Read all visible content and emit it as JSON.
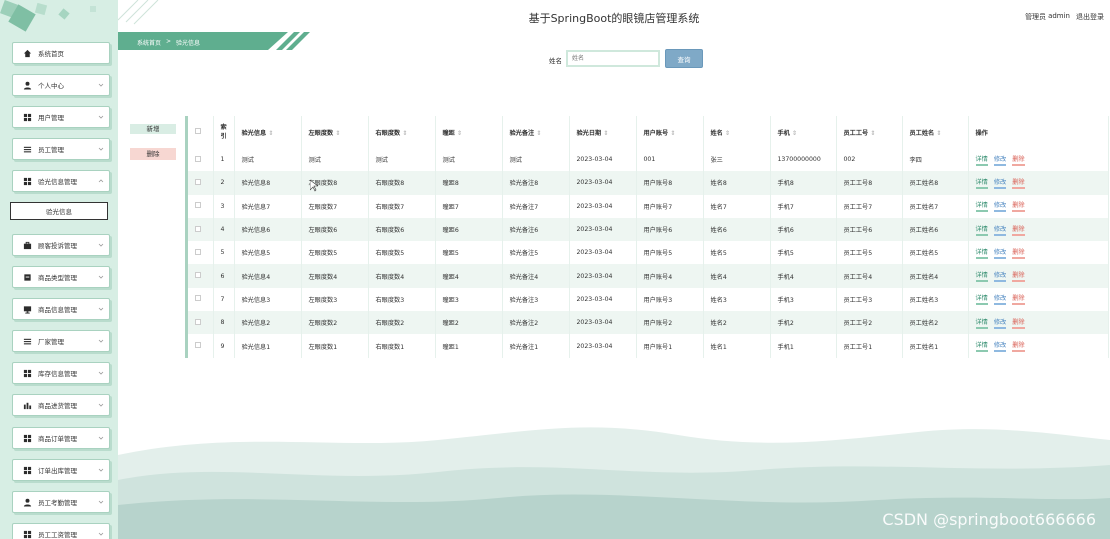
{
  "header": {
    "title": "基于SpringBoot的眼镜店管理系统",
    "user_role": "管理员",
    "username": "admin",
    "logout": "退出登录"
  },
  "breadcrumb": {
    "home": "系统首页",
    "sep": ">",
    "current": "验光信息"
  },
  "sidebar": {
    "items": [
      {
        "label": "系统首页",
        "icon": "home-icon"
      },
      {
        "label": "个人中心",
        "icon": "user-icon"
      },
      {
        "label": "用户管理",
        "icon": "grid-icon"
      },
      {
        "label": "员工管理",
        "icon": "list-icon"
      },
      {
        "label": "验光信息管理",
        "icon": "grid-icon"
      },
      {
        "label": "顾客投诉管理",
        "icon": "briefcase-icon"
      },
      {
        "label": "商品类型管理",
        "icon": "box-icon"
      },
      {
        "label": "商品信息管理",
        "icon": "monitor-icon"
      },
      {
        "label": "厂家管理",
        "icon": "list-icon"
      },
      {
        "label": "库存信息管理",
        "icon": "grid-icon"
      },
      {
        "label": "商品进货管理",
        "icon": "chart-icon"
      },
      {
        "label": "商品订单管理",
        "icon": "grid-icon"
      },
      {
        "label": "订单出库管理",
        "icon": "grid-icon"
      },
      {
        "label": "员工考勤管理",
        "icon": "user-icon"
      },
      {
        "label": "员工工资管理",
        "icon": "grid-icon"
      }
    ],
    "sub_item": "验光信息"
  },
  "search": {
    "label": "姓名",
    "placeholder": "姓名",
    "button": "查询"
  },
  "actions": {
    "add": "新增",
    "delete": "删除"
  },
  "table": {
    "columns": [
      "索引",
      "验光信息",
      "左眼度数",
      "右眼度数",
      "瞳距",
      "验光备注",
      "验光日期",
      "用户账号",
      "姓名",
      "手机",
      "员工工号",
      "员工姓名",
      "操作"
    ],
    "rows": [
      [
        "1",
        "测试",
        "测试",
        "测试",
        "测试",
        "测试",
        "2023-03-04",
        "001",
        "张三",
        "13700000000",
        "002",
        "李四"
      ],
      [
        "2",
        "验光信息8",
        "左眼度数8",
        "右眼度数8",
        "瞳距8",
        "验光备注8",
        "2023-03-04",
        "用户账号8",
        "姓名8",
        "手机8",
        "员工工号8",
        "员工姓名8"
      ],
      [
        "3",
        "验光信息7",
        "左眼度数7",
        "右眼度数7",
        "瞳距7",
        "验光备注7",
        "2023-03-04",
        "用户账号7",
        "姓名7",
        "手机7",
        "员工工号7",
        "员工姓名7"
      ],
      [
        "4",
        "验光信息6",
        "左眼度数6",
        "右眼度数6",
        "瞳距6",
        "验光备注6",
        "2023-03-04",
        "用户账号6",
        "姓名6",
        "手机6",
        "员工工号6",
        "员工姓名6"
      ],
      [
        "5",
        "验光信息5",
        "左眼度数5",
        "右眼度数5",
        "瞳距5",
        "验光备注5",
        "2023-03-04",
        "用户账号5",
        "姓名5",
        "手机5",
        "员工工号5",
        "员工姓名5"
      ],
      [
        "6",
        "验光信息4",
        "左眼度数4",
        "右眼度数4",
        "瞳距4",
        "验光备注4",
        "2023-03-04",
        "用户账号4",
        "姓名4",
        "手机4",
        "员工工号4",
        "员工姓名4"
      ],
      [
        "7",
        "验光信息3",
        "左眼度数3",
        "右眼度数3",
        "瞳距3",
        "验光备注3",
        "2023-03-04",
        "用户账号3",
        "姓名3",
        "手机3",
        "员工工号3",
        "员工姓名3"
      ],
      [
        "8",
        "验光信息2",
        "左眼度数2",
        "右眼度数2",
        "瞳距2",
        "验光备注2",
        "2023-03-04",
        "用户账号2",
        "姓名2",
        "手机2",
        "员工工号2",
        "员工姓名2"
      ],
      [
        "9",
        "验光信息1",
        "左眼度数1",
        "右眼度数1",
        "瞳距1",
        "验光备注1",
        "2023-03-04",
        "用户账号1",
        "姓名1",
        "手机1",
        "员工工号1",
        "员工姓名1"
      ]
    ],
    "row_actions": {
      "view": "详情",
      "edit": "修改",
      "delete": "删除"
    }
  },
  "watermark": "CSDN @springboot666666",
  "colors": {
    "accent": "#5fae8f",
    "sidebar_bg": "#d7eee4",
    "search_button": "#7fa9c7",
    "delete_link": "#d85b50"
  }
}
